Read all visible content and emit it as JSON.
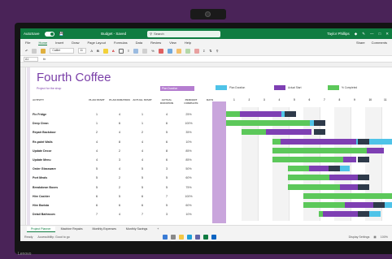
{
  "device": {
    "brand": "Lenovo"
  },
  "titlebar": {
    "autosave_label": "AutoSave",
    "autosave_state": "On",
    "filename": "Budget - Saved",
    "search_placeholder": "Search",
    "user": "Taylor Phillips"
  },
  "menu": {
    "items": [
      "File",
      "Home",
      "Insert",
      "Draw",
      "Page Layout",
      "Formulas",
      "Data",
      "Review",
      "View",
      "Help"
    ],
    "active_index": 1,
    "share_label": "Share",
    "comments_label": "Comments"
  },
  "ribbon": {
    "font": "Calibri",
    "size": "11"
  },
  "formula_bar": {
    "cell_ref": "A1",
    "fx": "fx"
  },
  "sheet": {
    "title": "Fourth Coffee",
    "subtitle": "Project for the shop",
    "highlight_label": "Plan Duration",
    "legend": [
      {
        "label": "Plan Duration",
        "color": "#4fc3e8"
      },
      {
        "label": "Actual Start",
        "color": "#7e3fb3"
      },
      {
        "label": "% Completed",
        "color": "#5cc85a"
      }
    ],
    "headers": [
      "ACTIVITY",
      "PLAN START",
      "PLAN DURATION",
      "ACTUAL START",
      "ACTUAL DURATION",
      "PERCENT COMPLETE",
      "DAYS"
    ],
    "week_numbers": [
      "1",
      "2",
      "3",
      "4",
      "5",
      "6",
      "7",
      "8",
      "9",
      "10",
      "11",
      "12"
    ],
    "rows": [
      {
        "name": "Fix Fridge",
        "ps": "1",
        "pd": "4",
        "as": "1",
        "ad": "4",
        "pct": "25%"
      },
      {
        "name": "Deep Clean",
        "ps": "1",
        "pd": "6",
        "as": "1",
        "ad": "6",
        "pct": "100%"
      },
      {
        "name": "Repair Backdoor",
        "ps": "2",
        "pd": "4",
        "as": "2",
        "ad": "5",
        "pct": "35%"
      },
      {
        "name": "Re-paint Walls",
        "ps": "4",
        "pd": "8",
        "as": "4",
        "ad": "6",
        "pct": "10%"
      },
      {
        "name": "Update Decor",
        "ps": "4",
        "pd": "2",
        "as": "4",
        "ad": "8",
        "pct": "85%"
      },
      {
        "name": "Update Menu",
        "ps": "4",
        "pd": "3",
        "as": "4",
        "ad": "6",
        "pct": "85%"
      },
      {
        "name": "Order Glassware",
        "ps": "5",
        "pd": "4",
        "as": "5",
        "ad": "3",
        "pct": "50%"
      },
      {
        "name": "Port Meals",
        "ps": "5",
        "pd": "2",
        "as": "5",
        "ad": "5",
        "pct": "60%"
      },
      {
        "name": "Breakdown Boxes",
        "ps": "5",
        "pd": "2",
        "as": "5",
        "ad": "5",
        "pct": "75%"
      },
      {
        "name": "Hire Cashier",
        "ps": "6",
        "pd": "5",
        "as": "6",
        "ad": "7",
        "pct": "100%"
      },
      {
        "name": "Hire Barista",
        "ps": "6",
        "pd": "6",
        "as": "6",
        "ad": "5",
        "pct": "60%"
      },
      {
        "name": "Detail Bathroom",
        "ps": "7",
        "pd": "4",
        "as": "7",
        "ad": "3",
        "pct": "10%"
      }
    ]
  },
  "tabs": [
    "Project Planner",
    "Machine Repairs",
    "Monthly Expenses",
    "Monthly Savings"
  ],
  "status": {
    "left": "Ready",
    "accessibility": "Accessibility: Good to go",
    "display_settings": "Display Settings",
    "zoom": "100%"
  }
}
